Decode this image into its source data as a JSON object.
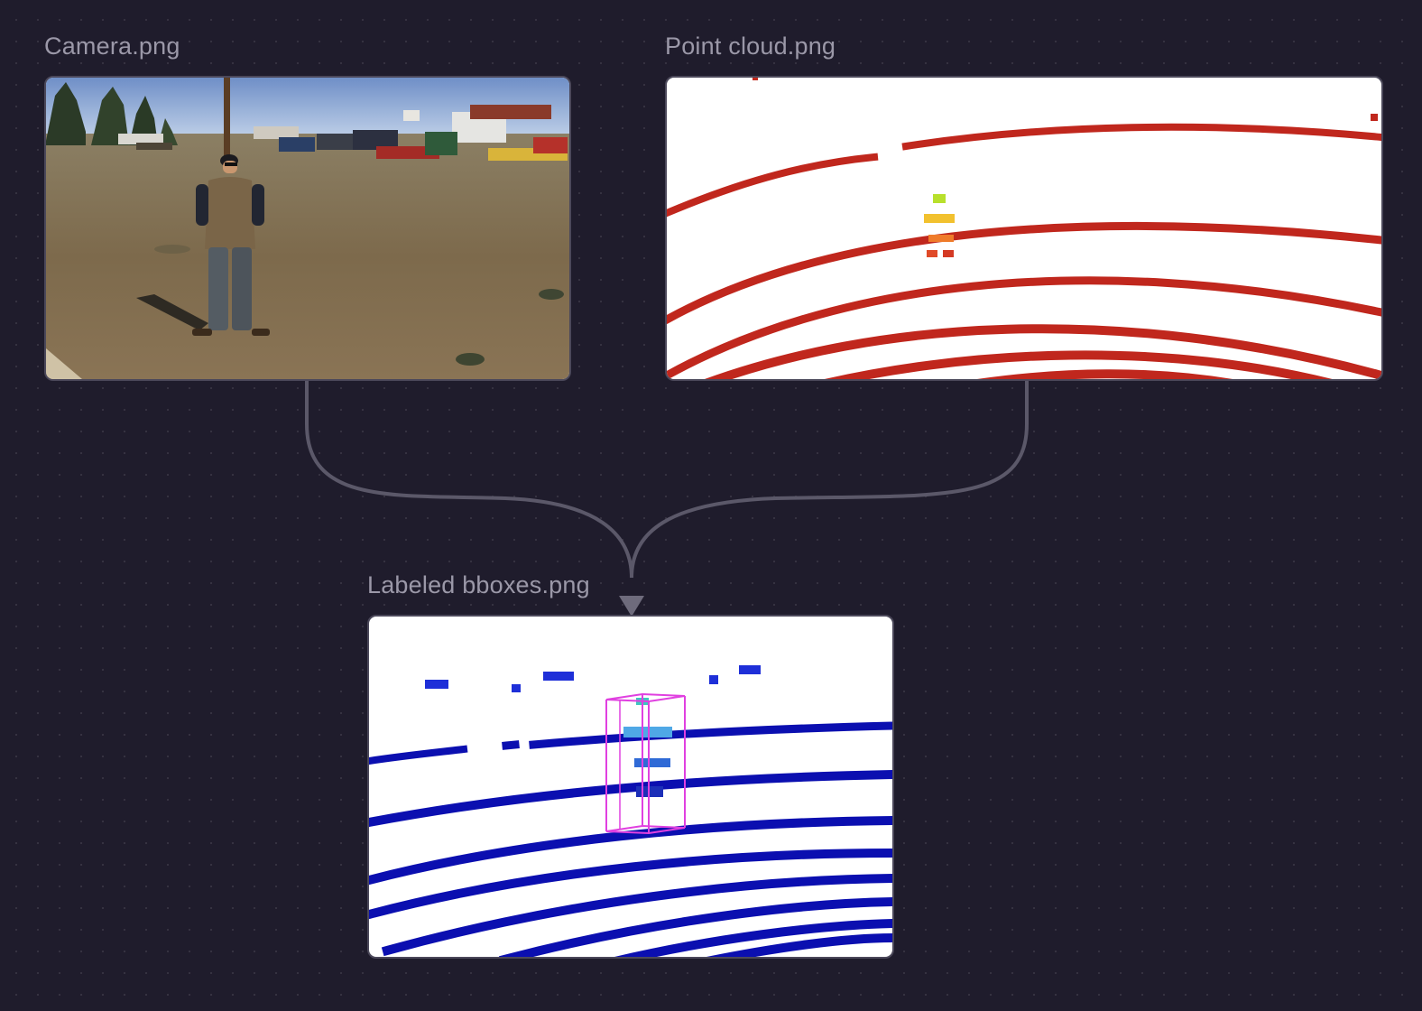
{
  "nodes": {
    "camera": {
      "title": "Camera.png"
    },
    "point_cloud": {
      "title": "Point cloud.png"
    },
    "labeled": {
      "title": "Labeled bboxes.png"
    }
  },
  "colors": {
    "canvas": "#1f1c2c",
    "node_border": "#4b485a",
    "connector": "#5b5869",
    "label": "#9b98a8",
    "lidar_red": "#c0271d",
    "lidar_blue": "#0b0fb0",
    "bbox": "#e040e0"
  },
  "icons": {
    "connector_arrow": "arrow-down-icon"
  }
}
